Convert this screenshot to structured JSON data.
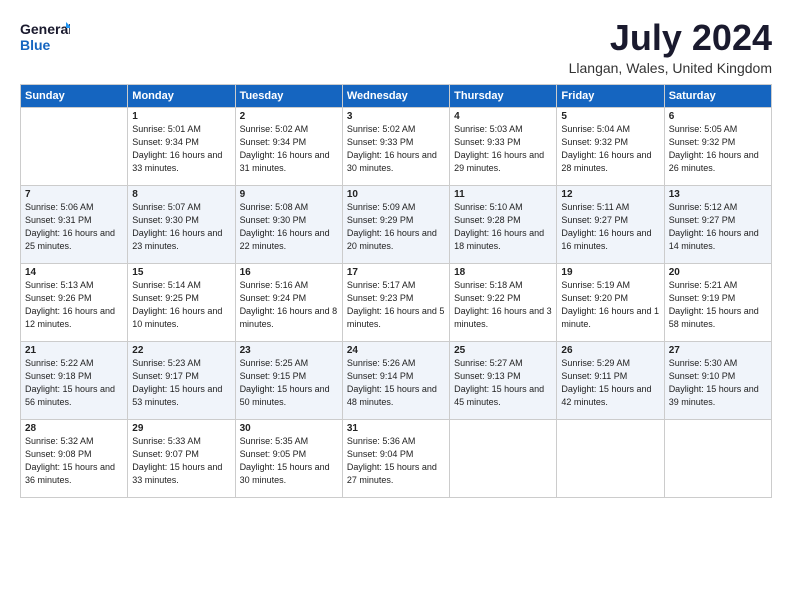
{
  "logo": {
    "line1": "General",
    "line2": "Blue"
  },
  "title": "July 2024",
  "subtitle": "Llangan, Wales, United Kingdom",
  "days_of_week": [
    "Sunday",
    "Monday",
    "Tuesday",
    "Wednesday",
    "Thursday",
    "Friday",
    "Saturday"
  ],
  "weeks": [
    [
      {
        "day": "",
        "sunrise": "",
        "sunset": "",
        "daylight": ""
      },
      {
        "day": "1",
        "sunrise": "5:01 AM",
        "sunset": "9:34 PM",
        "daylight": "16 hours and 33 minutes."
      },
      {
        "day": "2",
        "sunrise": "5:02 AM",
        "sunset": "9:34 PM",
        "daylight": "16 hours and 31 minutes."
      },
      {
        "day": "3",
        "sunrise": "5:02 AM",
        "sunset": "9:33 PM",
        "daylight": "16 hours and 30 minutes."
      },
      {
        "day": "4",
        "sunrise": "5:03 AM",
        "sunset": "9:33 PM",
        "daylight": "16 hours and 29 minutes."
      },
      {
        "day": "5",
        "sunrise": "5:04 AM",
        "sunset": "9:32 PM",
        "daylight": "16 hours and 28 minutes."
      },
      {
        "day": "6",
        "sunrise": "5:05 AM",
        "sunset": "9:32 PM",
        "daylight": "16 hours and 26 minutes."
      }
    ],
    [
      {
        "day": "7",
        "sunrise": "5:06 AM",
        "sunset": "9:31 PM",
        "daylight": "16 hours and 25 minutes."
      },
      {
        "day": "8",
        "sunrise": "5:07 AM",
        "sunset": "9:30 PM",
        "daylight": "16 hours and 23 minutes."
      },
      {
        "day": "9",
        "sunrise": "5:08 AM",
        "sunset": "9:30 PM",
        "daylight": "16 hours and 22 minutes."
      },
      {
        "day": "10",
        "sunrise": "5:09 AM",
        "sunset": "9:29 PM",
        "daylight": "16 hours and 20 minutes."
      },
      {
        "day": "11",
        "sunrise": "5:10 AM",
        "sunset": "9:28 PM",
        "daylight": "16 hours and 18 minutes."
      },
      {
        "day": "12",
        "sunrise": "5:11 AM",
        "sunset": "9:27 PM",
        "daylight": "16 hours and 16 minutes."
      },
      {
        "day": "13",
        "sunrise": "5:12 AM",
        "sunset": "9:27 PM",
        "daylight": "16 hours and 14 minutes."
      }
    ],
    [
      {
        "day": "14",
        "sunrise": "5:13 AM",
        "sunset": "9:26 PM",
        "daylight": "16 hours and 12 minutes."
      },
      {
        "day": "15",
        "sunrise": "5:14 AM",
        "sunset": "9:25 PM",
        "daylight": "16 hours and 10 minutes."
      },
      {
        "day": "16",
        "sunrise": "5:16 AM",
        "sunset": "9:24 PM",
        "daylight": "16 hours and 8 minutes."
      },
      {
        "day": "17",
        "sunrise": "5:17 AM",
        "sunset": "9:23 PM",
        "daylight": "16 hours and 5 minutes."
      },
      {
        "day": "18",
        "sunrise": "5:18 AM",
        "sunset": "9:22 PM",
        "daylight": "16 hours and 3 minutes."
      },
      {
        "day": "19",
        "sunrise": "5:19 AM",
        "sunset": "9:20 PM",
        "daylight": "16 hours and 1 minute."
      },
      {
        "day": "20",
        "sunrise": "5:21 AM",
        "sunset": "9:19 PM",
        "daylight": "15 hours and 58 minutes."
      }
    ],
    [
      {
        "day": "21",
        "sunrise": "5:22 AM",
        "sunset": "9:18 PM",
        "daylight": "15 hours and 56 minutes."
      },
      {
        "day": "22",
        "sunrise": "5:23 AM",
        "sunset": "9:17 PM",
        "daylight": "15 hours and 53 minutes."
      },
      {
        "day": "23",
        "sunrise": "5:25 AM",
        "sunset": "9:15 PM",
        "daylight": "15 hours and 50 minutes."
      },
      {
        "day": "24",
        "sunrise": "5:26 AM",
        "sunset": "9:14 PM",
        "daylight": "15 hours and 48 minutes."
      },
      {
        "day": "25",
        "sunrise": "5:27 AM",
        "sunset": "9:13 PM",
        "daylight": "15 hours and 45 minutes."
      },
      {
        "day": "26",
        "sunrise": "5:29 AM",
        "sunset": "9:11 PM",
        "daylight": "15 hours and 42 minutes."
      },
      {
        "day": "27",
        "sunrise": "5:30 AM",
        "sunset": "9:10 PM",
        "daylight": "15 hours and 39 minutes."
      }
    ],
    [
      {
        "day": "28",
        "sunrise": "5:32 AM",
        "sunset": "9:08 PM",
        "daylight": "15 hours and 36 minutes."
      },
      {
        "day": "29",
        "sunrise": "5:33 AM",
        "sunset": "9:07 PM",
        "daylight": "15 hours and 33 minutes."
      },
      {
        "day": "30",
        "sunrise": "5:35 AM",
        "sunset": "9:05 PM",
        "daylight": "15 hours and 30 minutes."
      },
      {
        "day": "31",
        "sunrise": "5:36 AM",
        "sunset": "9:04 PM",
        "daylight": "15 hours and 27 minutes."
      },
      {
        "day": "",
        "sunrise": "",
        "sunset": "",
        "daylight": ""
      },
      {
        "day": "",
        "sunrise": "",
        "sunset": "",
        "daylight": ""
      },
      {
        "day": "",
        "sunrise": "",
        "sunset": "",
        "daylight": ""
      }
    ]
  ]
}
